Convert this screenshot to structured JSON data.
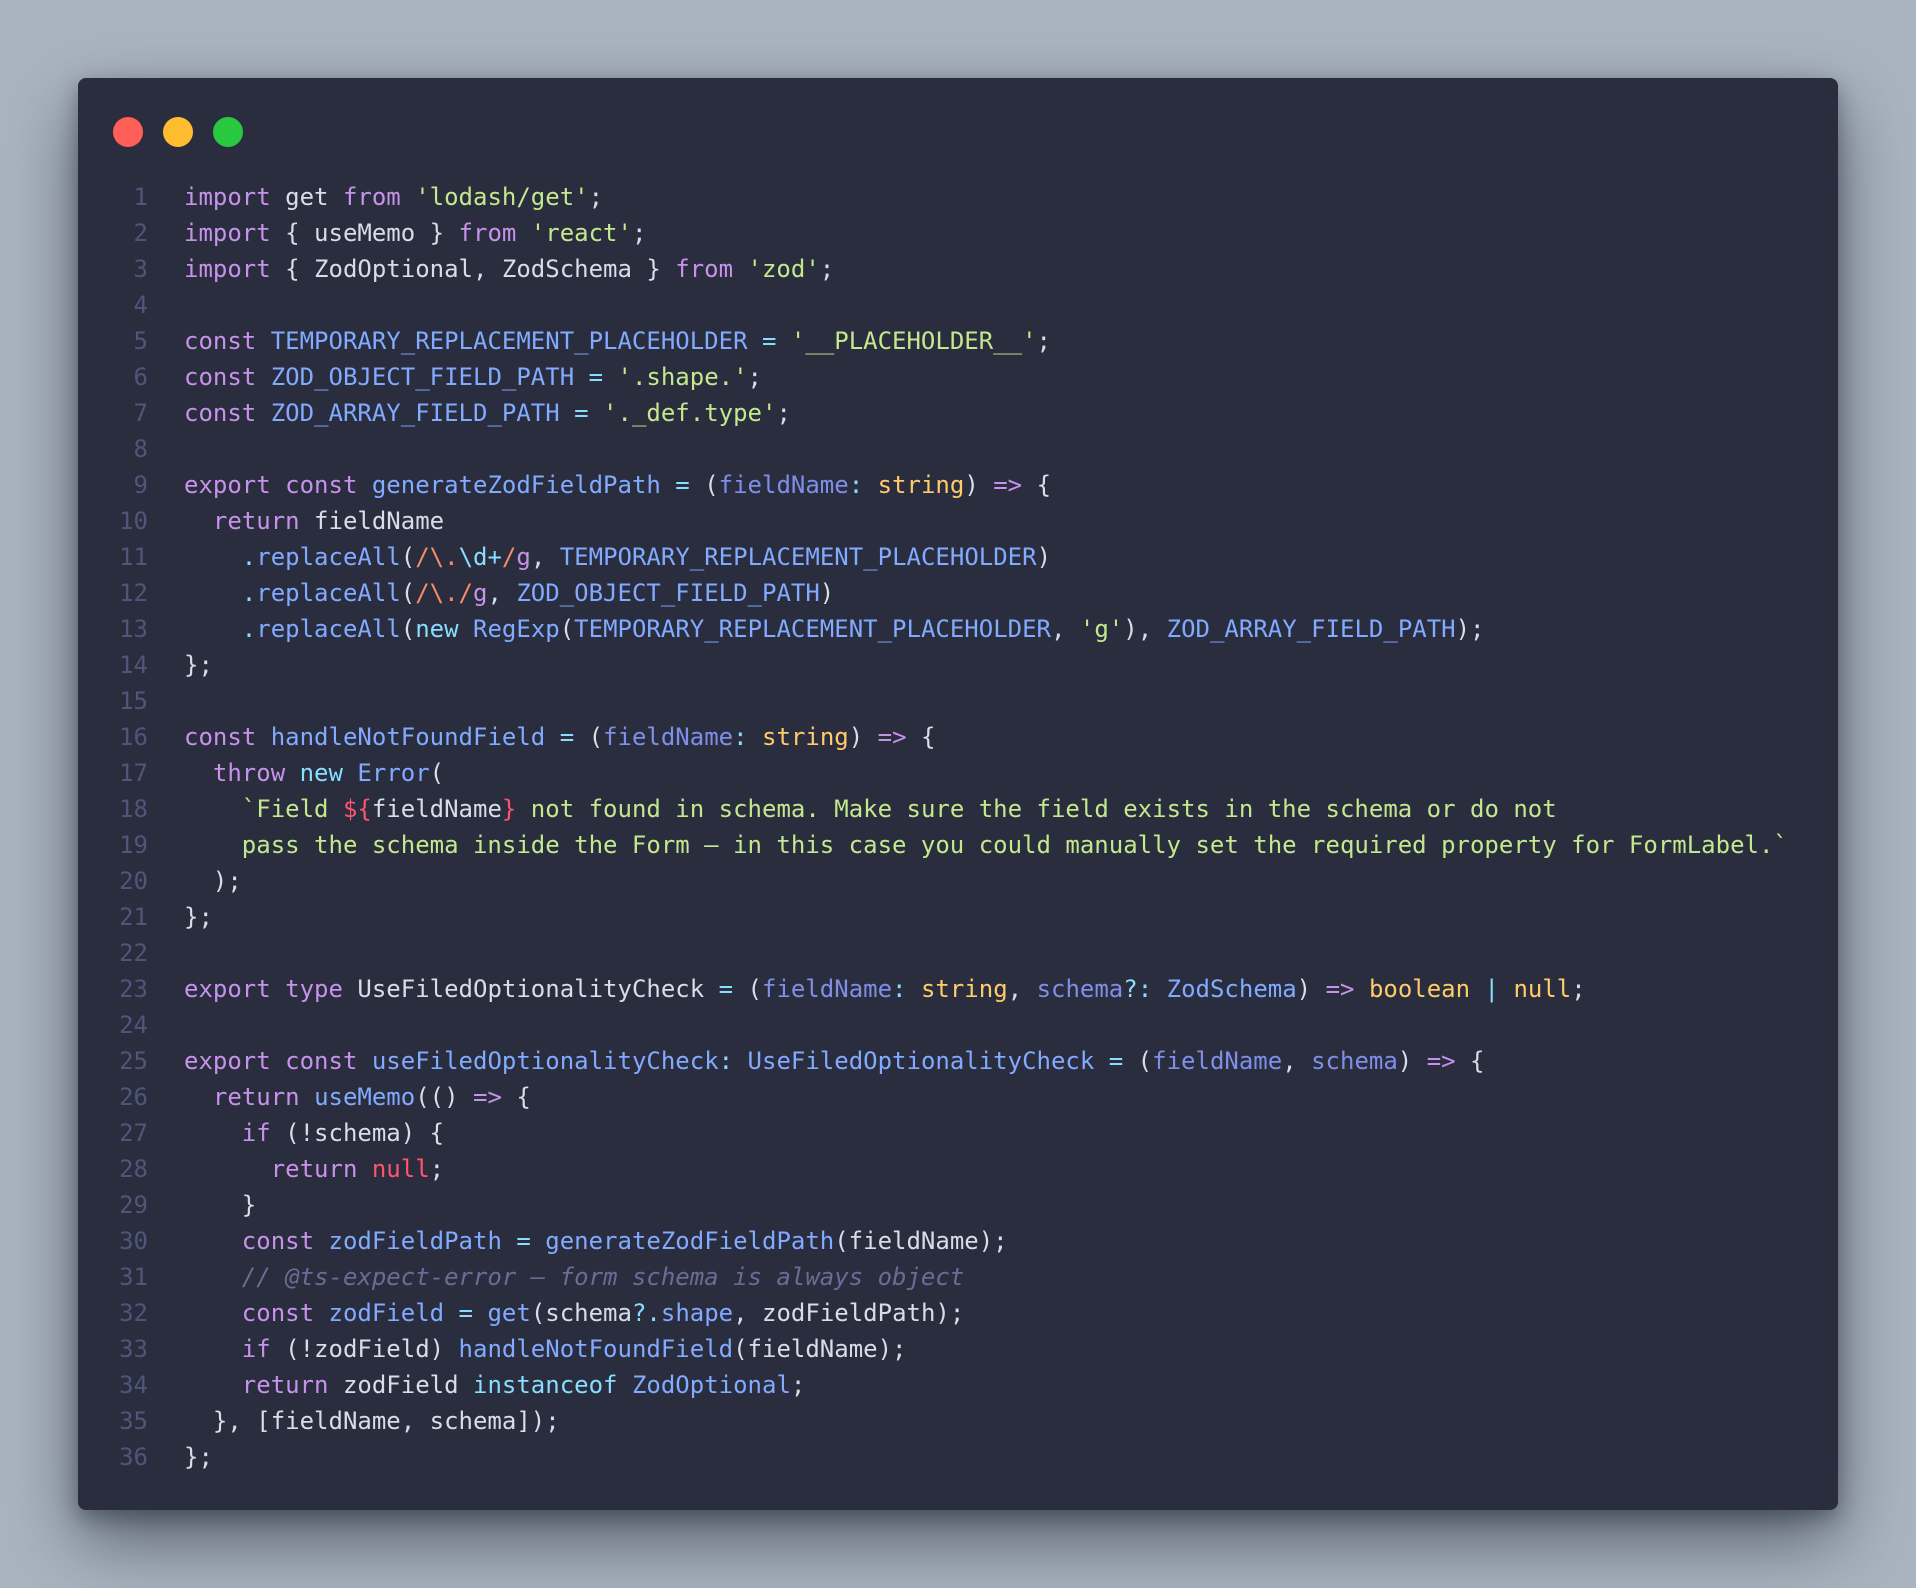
{
  "window": {
    "traffic_lights": {
      "close_color": "#ff5f57",
      "minimize_color": "#febc2e",
      "maximize_color": "#28c840"
    }
  },
  "code": {
    "language": "typescript",
    "lines": [
      {
        "n": "1",
        "tokens": [
          [
            "kw",
            "import"
          ],
          [
            "plain",
            " get "
          ],
          [
            "kw",
            "from"
          ],
          [
            "plain",
            " "
          ],
          [
            "str",
            "'lodash/get'"
          ],
          [
            "punc",
            ";"
          ]
        ]
      },
      {
        "n": "2",
        "tokens": [
          [
            "kw",
            "import"
          ],
          [
            "plain",
            " { useMemo } "
          ],
          [
            "kw",
            "from"
          ],
          [
            "plain",
            " "
          ],
          [
            "str",
            "'react'"
          ],
          [
            "punc",
            ";"
          ]
        ]
      },
      {
        "n": "3",
        "tokens": [
          [
            "kw",
            "import"
          ],
          [
            "plain",
            " { ZodOptional, ZodSchema } "
          ],
          [
            "kw",
            "from"
          ],
          [
            "plain",
            " "
          ],
          [
            "str",
            "'zod'"
          ],
          [
            "punc",
            ";"
          ]
        ]
      },
      {
        "n": "4",
        "tokens": []
      },
      {
        "n": "5",
        "tokens": [
          [
            "kw",
            "const"
          ],
          [
            "plain",
            " "
          ],
          [
            "const",
            "TEMPORARY_REPLACEMENT_PLACEHOLDER"
          ],
          [
            "plain",
            " "
          ],
          [
            "op",
            "="
          ],
          [
            "plain",
            " "
          ],
          [
            "str",
            "'__PLACEHOLDER__'"
          ],
          [
            "punc",
            ";"
          ]
        ]
      },
      {
        "n": "6",
        "tokens": [
          [
            "kw",
            "const"
          ],
          [
            "plain",
            " "
          ],
          [
            "const",
            "ZOD_OBJECT_FIELD_PATH"
          ],
          [
            "plain",
            " "
          ],
          [
            "op",
            "="
          ],
          [
            "plain",
            " "
          ],
          [
            "str",
            "'.shape.'"
          ],
          [
            "punc",
            ";"
          ]
        ]
      },
      {
        "n": "7",
        "tokens": [
          [
            "kw",
            "const"
          ],
          [
            "plain",
            " "
          ],
          [
            "const",
            "ZOD_ARRAY_FIELD_PATH"
          ],
          [
            "plain",
            " "
          ],
          [
            "op",
            "="
          ],
          [
            "plain",
            " "
          ],
          [
            "str",
            "'._def.type'"
          ],
          [
            "punc",
            ";"
          ]
        ]
      },
      {
        "n": "8",
        "tokens": []
      },
      {
        "n": "9",
        "tokens": [
          [
            "kw",
            "export"
          ],
          [
            "plain",
            " "
          ],
          [
            "kw",
            "const"
          ],
          [
            "plain",
            " "
          ],
          [
            "fn",
            "generateZodFieldPath"
          ],
          [
            "plain",
            " "
          ],
          [
            "op",
            "="
          ],
          [
            "plain",
            " ("
          ],
          [
            "param",
            "fieldName"
          ],
          [
            "op",
            ":"
          ],
          [
            "plain",
            " "
          ],
          [
            "type",
            "string"
          ],
          [
            "plain",
            ") "
          ],
          [
            "kw",
            "=>"
          ],
          [
            "plain",
            " {"
          ]
        ]
      },
      {
        "n": "10",
        "tokens": [
          [
            "plain",
            "  "
          ],
          [
            "kw",
            "return"
          ],
          [
            "plain",
            " fieldName"
          ]
        ]
      },
      {
        "n": "11",
        "tokens": [
          [
            "plain",
            "    "
          ],
          [
            "op",
            "."
          ],
          [
            "fn",
            "replaceAll"
          ],
          [
            "punc",
            "("
          ],
          [
            "regex",
            "/\\."
          ],
          [
            "op",
            "\\d+"
          ],
          [
            "regex",
            "/"
          ],
          [
            "kw",
            "g"
          ],
          [
            "punc",
            ", "
          ],
          [
            "const",
            "TEMPORARY_REPLACEMENT_PLACEHOLDER"
          ],
          [
            "punc",
            ")"
          ]
        ]
      },
      {
        "n": "12",
        "tokens": [
          [
            "plain",
            "    "
          ],
          [
            "op",
            "."
          ],
          [
            "fn",
            "replaceAll"
          ],
          [
            "punc",
            "("
          ],
          [
            "regex",
            "/\\./"
          ],
          [
            "kw",
            "g"
          ],
          [
            "punc",
            ", "
          ],
          [
            "const",
            "ZOD_OBJECT_FIELD_PATH"
          ],
          [
            "punc",
            ")"
          ]
        ]
      },
      {
        "n": "13",
        "tokens": [
          [
            "plain",
            "    "
          ],
          [
            "op",
            "."
          ],
          [
            "fn",
            "replaceAll"
          ],
          [
            "punc",
            "("
          ],
          [
            "op",
            "new"
          ],
          [
            "plain",
            " "
          ],
          [
            "fn",
            "RegExp"
          ],
          [
            "punc",
            "("
          ],
          [
            "const",
            "TEMPORARY_REPLACEMENT_PLACEHOLDER"
          ],
          [
            "punc",
            ", "
          ],
          [
            "str",
            "'g'"
          ],
          [
            "punc",
            "), "
          ],
          [
            "const",
            "ZOD_ARRAY_FIELD_PATH"
          ],
          [
            "punc",
            ");"
          ]
        ]
      },
      {
        "n": "14",
        "tokens": [
          [
            "punc",
            "};"
          ]
        ]
      },
      {
        "n": "15",
        "tokens": []
      },
      {
        "n": "16",
        "tokens": [
          [
            "kw",
            "const"
          ],
          [
            "plain",
            " "
          ],
          [
            "fn",
            "handleNotFoundField"
          ],
          [
            "plain",
            " "
          ],
          [
            "op",
            "="
          ],
          [
            "plain",
            " ("
          ],
          [
            "param",
            "fieldName"
          ],
          [
            "op",
            ":"
          ],
          [
            "plain",
            " "
          ],
          [
            "type",
            "string"
          ],
          [
            "plain",
            ") "
          ],
          [
            "kw",
            "=>"
          ],
          [
            "plain",
            " {"
          ]
        ]
      },
      {
        "n": "17",
        "tokens": [
          [
            "plain",
            "  "
          ],
          [
            "kw",
            "throw"
          ],
          [
            "plain",
            " "
          ],
          [
            "op",
            "new"
          ],
          [
            "plain",
            " "
          ],
          [
            "fn",
            "Error"
          ],
          [
            "punc",
            "("
          ]
        ]
      },
      {
        "n": "18",
        "tokens": [
          [
            "plain",
            "    "
          ],
          [
            "str",
            "`Field "
          ],
          [
            "interp",
            "${"
          ],
          [
            "plain",
            "fieldName"
          ],
          [
            "interp",
            "}"
          ],
          [
            "str",
            " not found in schema. Make sure the field exists in the schema or do not"
          ]
        ]
      },
      {
        "n": "19",
        "tokens": [
          [
            "plain",
            "    "
          ],
          [
            "str",
            "pass the schema inside the Form – in this case you could manually set the required property for FormLabel.`"
          ]
        ]
      },
      {
        "n": "20",
        "tokens": [
          [
            "plain",
            "  "
          ],
          [
            "punc",
            ");"
          ]
        ]
      },
      {
        "n": "21",
        "tokens": [
          [
            "punc",
            "};"
          ]
        ]
      },
      {
        "n": "22",
        "tokens": []
      },
      {
        "n": "23",
        "tokens": [
          [
            "kw",
            "export"
          ],
          [
            "plain",
            " "
          ],
          [
            "kw",
            "type"
          ],
          [
            "plain",
            " UseFiledOptionalityCheck "
          ],
          [
            "op",
            "="
          ],
          [
            "plain",
            " ("
          ],
          [
            "param",
            "fieldName"
          ],
          [
            "op",
            ":"
          ],
          [
            "plain",
            " "
          ],
          [
            "type",
            "string"
          ],
          [
            "punc",
            ", "
          ],
          [
            "param",
            "schema"
          ],
          [
            "op",
            "?:"
          ],
          [
            "plain",
            " "
          ],
          [
            "const",
            "ZodSchema"
          ],
          [
            "plain",
            ") "
          ],
          [
            "kw",
            "=>"
          ],
          [
            "plain",
            " "
          ],
          [
            "type",
            "boolean"
          ],
          [
            "plain",
            " "
          ],
          [
            "op",
            "|"
          ],
          [
            "plain",
            " "
          ],
          [
            "type",
            "null"
          ],
          [
            "punc",
            ";"
          ]
        ]
      },
      {
        "n": "24",
        "tokens": []
      },
      {
        "n": "25",
        "tokens": [
          [
            "kw",
            "export"
          ],
          [
            "plain",
            " "
          ],
          [
            "kw",
            "const"
          ],
          [
            "plain",
            " "
          ],
          [
            "fn",
            "useFiledOptionalityCheck"
          ],
          [
            "op",
            ":"
          ],
          [
            "plain",
            " "
          ],
          [
            "const",
            "UseFiledOptionalityCheck"
          ],
          [
            "plain",
            " "
          ],
          [
            "op",
            "="
          ],
          [
            "plain",
            " ("
          ],
          [
            "param",
            "fieldName"
          ],
          [
            "punc",
            ", "
          ],
          [
            "param",
            "schema"
          ],
          [
            "plain",
            ") "
          ],
          [
            "kw",
            "=>"
          ],
          [
            "plain",
            " {"
          ]
        ]
      },
      {
        "n": "26",
        "tokens": [
          [
            "plain",
            "  "
          ],
          [
            "kw",
            "return"
          ],
          [
            "plain",
            " "
          ],
          [
            "fn",
            "useMemo"
          ],
          [
            "punc",
            "(() "
          ],
          [
            "kw",
            "=>"
          ],
          [
            "plain",
            " {"
          ]
        ]
      },
      {
        "n": "27",
        "tokens": [
          [
            "plain",
            "    "
          ],
          [
            "kw",
            "if"
          ],
          [
            "plain",
            " (!schema) {"
          ]
        ]
      },
      {
        "n": "28",
        "tokens": [
          [
            "plain",
            "      "
          ],
          [
            "kw",
            "return"
          ],
          [
            "plain",
            " "
          ],
          [
            "null",
            "null"
          ],
          [
            "punc",
            ";"
          ]
        ]
      },
      {
        "n": "29",
        "tokens": [
          [
            "plain",
            "    }"
          ]
        ]
      },
      {
        "n": "30",
        "tokens": [
          [
            "plain",
            "    "
          ],
          [
            "kw",
            "const"
          ],
          [
            "plain",
            " "
          ],
          [
            "const",
            "zodFieldPath"
          ],
          [
            "plain",
            " "
          ],
          [
            "op",
            "="
          ],
          [
            "plain",
            " "
          ],
          [
            "fn",
            "generateZodFieldPath"
          ],
          [
            "punc",
            "(fieldName);"
          ]
        ]
      },
      {
        "n": "31",
        "tokens": [
          [
            "plain",
            "    "
          ],
          [
            "comment",
            "// @ts-expect-error – form schema is always object"
          ]
        ]
      },
      {
        "n": "32",
        "tokens": [
          [
            "plain",
            "    "
          ],
          [
            "kw",
            "const"
          ],
          [
            "plain",
            " "
          ],
          [
            "const",
            "zodField"
          ],
          [
            "plain",
            " "
          ],
          [
            "op",
            "="
          ],
          [
            "plain",
            " "
          ],
          [
            "fn",
            "get"
          ],
          [
            "punc",
            "(schema"
          ],
          [
            "op",
            "?."
          ],
          [
            "const",
            "shape"
          ],
          [
            "punc",
            ", zodFieldPath);"
          ]
        ]
      },
      {
        "n": "33",
        "tokens": [
          [
            "plain",
            "    "
          ],
          [
            "kw",
            "if"
          ],
          [
            "plain",
            " (!zodField) "
          ],
          [
            "fn",
            "handleNotFoundField"
          ],
          [
            "punc",
            "(fieldName);"
          ]
        ]
      },
      {
        "n": "34",
        "tokens": [
          [
            "plain",
            "    "
          ],
          [
            "kw",
            "return"
          ],
          [
            "plain",
            " zodField "
          ],
          [
            "op",
            "instanceof"
          ],
          [
            "plain",
            " "
          ],
          [
            "const",
            "ZodOptional"
          ],
          [
            "punc",
            ";"
          ]
        ]
      },
      {
        "n": "35",
        "tokens": [
          [
            "plain",
            "  }, [fieldName, schema]);"
          ]
        ]
      },
      {
        "n": "36",
        "tokens": [
          [
            "punc",
            "};"
          ]
        ]
      }
    ]
  }
}
